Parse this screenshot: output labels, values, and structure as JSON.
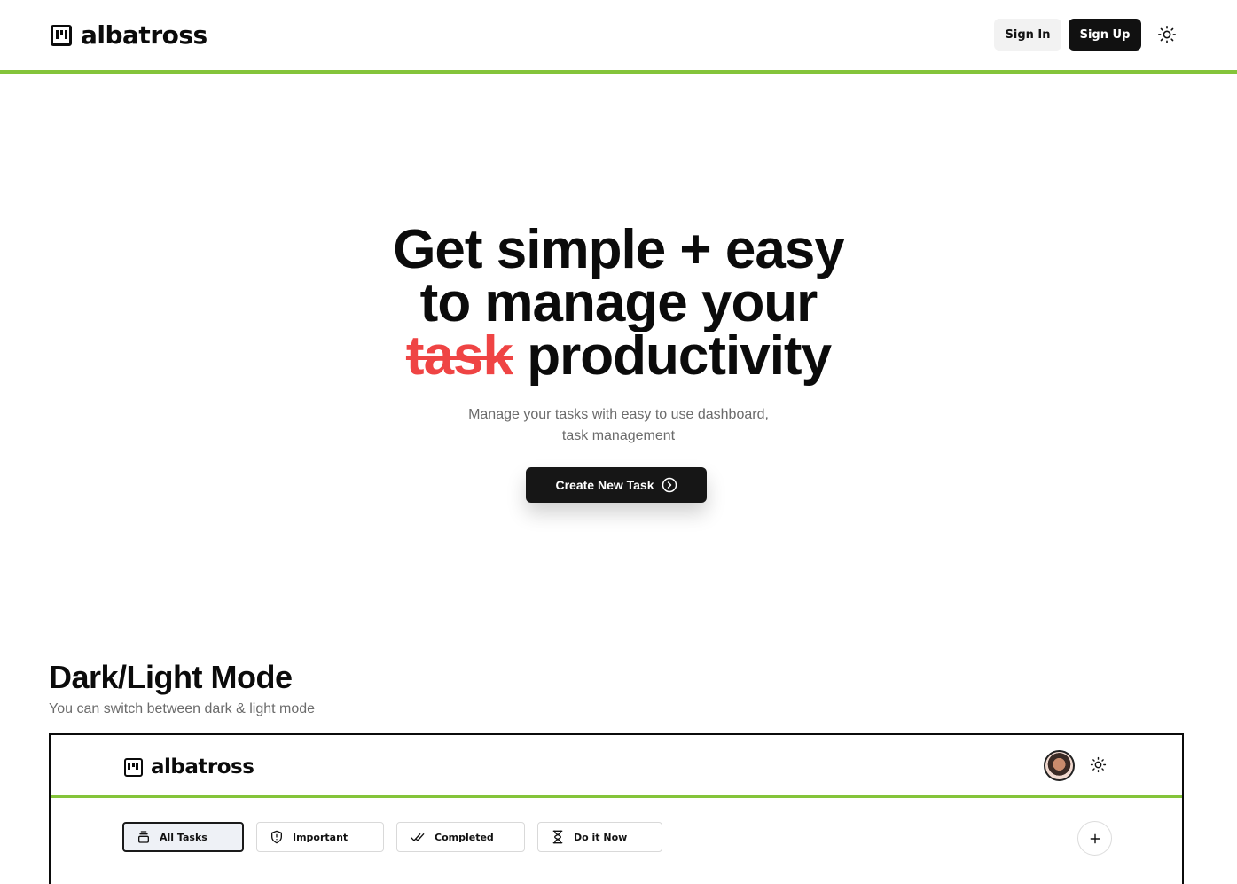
{
  "brand": {
    "name": "albatross"
  },
  "nav": {
    "sign_in_label": "Sign In",
    "sign_up_label": "Sign Up",
    "theme_toggle_icon": "sun-icon"
  },
  "hero": {
    "title_line1": "Get simple + easy",
    "title_line2": "to manage your",
    "title_strike": "task",
    "title_line3_rest": "productivity",
    "subtitle_line1": "Manage your tasks with easy to use dashboard,",
    "subtitle_line2": "task management",
    "cta_label": "Create New Task",
    "cta_icon": "chevron-right-circle-icon"
  },
  "feature": {
    "title": "Dark/Light Mode",
    "subtitle": "You can switch between dark & light mode"
  },
  "preview": {
    "brand": "albatross",
    "avatar_icon": "avatar",
    "theme_toggle_icon": "sun-icon",
    "tabs": [
      {
        "label": "All Tasks",
        "icon": "stack-icon",
        "active": true
      },
      {
        "label": "Important",
        "icon": "shield-alert-icon",
        "active": false
      },
      {
        "label": "Completed",
        "icon": "double-check-icon",
        "active": false
      },
      {
        "label": "Do it Now",
        "icon": "hourglass-icon",
        "active": false
      }
    ],
    "add_icon": "plus-icon"
  },
  "colors": {
    "accent_green": "#84c43a",
    "strike_red": "#ef4444",
    "dark": "#111111"
  }
}
